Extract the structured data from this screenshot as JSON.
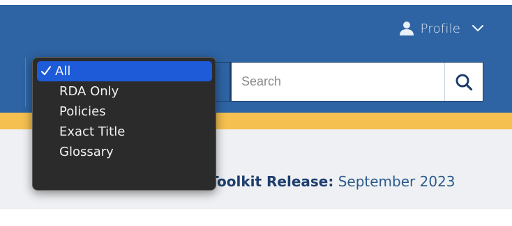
{
  "header": {
    "profile_label": "Profile",
    "profile_icon": "person-icon",
    "menu_icon": "chevron-down-icon"
  },
  "search": {
    "placeholder": "Search",
    "value": "",
    "button_icon": "magnifier-icon"
  },
  "dropdown": {
    "selected": "All",
    "options": [
      "All",
      "RDA Only",
      "Policies",
      "Exact Title",
      "Glossary"
    ]
  },
  "release": {
    "label": "Toolkit Release:",
    "value": "September 2023"
  },
  "colors": {
    "header_bg": "#2e64a4",
    "accent_bar": "#f5c04f",
    "content_bg": "#eef0f3",
    "menu_bg": "#2b2b2c",
    "menu_highlight": "#1d5bd8"
  }
}
